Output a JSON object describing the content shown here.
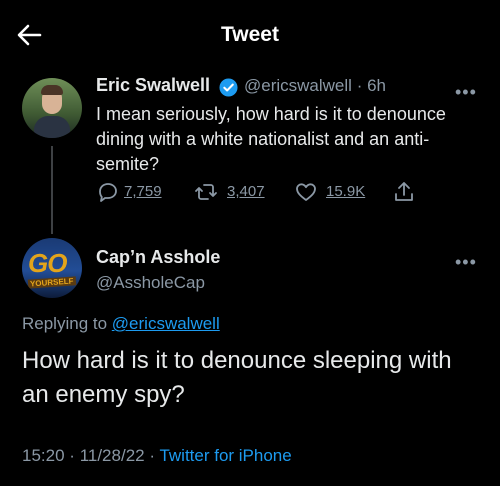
{
  "header": {
    "title": "Tweet"
  },
  "original_tweet": {
    "author_name": "Eric Swalwell",
    "handle": "@ericswalwell",
    "separator": "·",
    "time": "6h",
    "text": "I mean seriously, how hard is it to denounce dining with a white nationalist and an anti-semite?",
    "replies": "7,759",
    "retweets": "3,407",
    "likes": "15.9K"
  },
  "reply_tweet": {
    "author_name": "Cap’n Asshole",
    "handle": "@AssholeCap",
    "avatar_text_1": "GO",
    "avatar_text_2": "YOURSELF",
    "replying_prefix": "Replying to",
    "replying_to": "@ericswalwell",
    "text": "How hard is it to denounce sleeping with an enemy spy?",
    "time": "15:20",
    "separator": "·",
    "date": "11/28/22",
    "source": "Twitter for iPhone"
  },
  "colors": {
    "background": "#000000",
    "text": "#e7e9ea",
    "muted": "#8b98a5",
    "link": "#1d9bf0"
  },
  "icons": [
    "back-arrow-icon",
    "verified-badge-icon",
    "more-icon",
    "reply-icon",
    "retweet-icon",
    "like-icon",
    "share-icon"
  ]
}
